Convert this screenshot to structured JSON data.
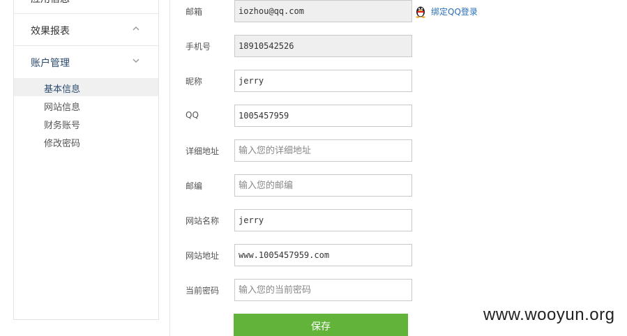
{
  "sidebar": {
    "top_label": "应用信息",
    "report_label": "效果报表",
    "account_label": "账户管理",
    "sub_items": [
      "基本信息",
      "网站信息",
      "财务账号",
      "修改密码"
    ]
  },
  "form": {
    "email": {
      "label": "邮箱",
      "value": "iozhou@qq.com"
    },
    "qq_bind_label": "绑定QQ登录",
    "phone": {
      "label": "手机号",
      "value": "18910542526"
    },
    "nickname": {
      "label": "昵称",
      "value": "jerry"
    },
    "qq": {
      "label": "QQ",
      "value": "1005457959"
    },
    "address": {
      "label": "详细地址",
      "placeholder": "输入您的详细地址"
    },
    "zipcode": {
      "label": "邮编",
      "placeholder": "输入您的邮编"
    },
    "site_name": {
      "label": "网站名称",
      "value": "jerry"
    },
    "site_url": {
      "label": "网站地址",
      "value": "www.1005457959.com"
    },
    "current_password": {
      "label": "当前密码",
      "placeholder": "输入您的当前密码"
    },
    "save_label": "保存"
  },
  "watermark": "www.wooyun.org",
  "colors": {
    "accent_green": "#62b33a",
    "link_blue": "#2a6fb8",
    "nav_active": "#2a4a6e"
  }
}
